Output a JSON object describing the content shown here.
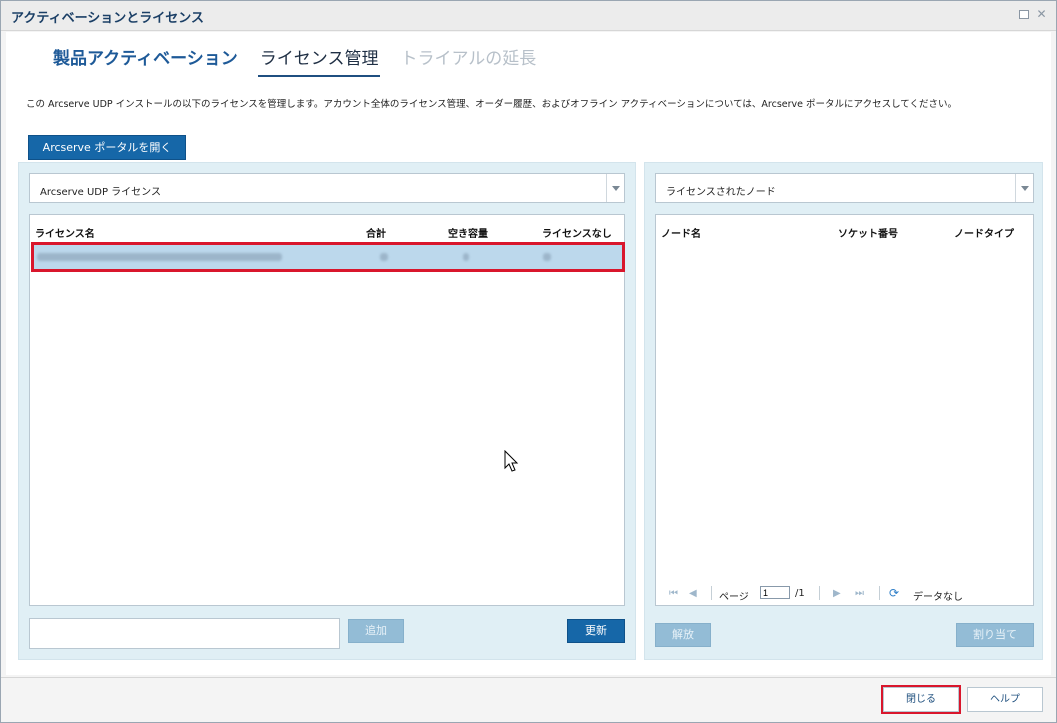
{
  "window": {
    "title": "アクティベーションとライセンス"
  },
  "tabs": [
    {
      "label": "製品アクティベーション"
    },
    {
      "label": "ライセンス管理"
    },
    {
      "label": "トライアルの延長"
    }
  ],
  "description": "この Arcserve UDP インストールの以下のライセンスを管理します。アカウント全体のライセンス管理、オーダー履歴、およびオフライン アクティベーションについては、Arcserve ポータルにアクセスしてください。",
  "portal_button": "Arcserve ポータルを開く",
  "left_panel": {
    "license_type": "Arcserve UDP ライセンス",
    "columns": [
      "ライセンス名",
      "合計",
      "空き容量",
      "ライセンスなし"
    ],
    "add_button": "追加",
    "refresh_button": "更新",
    "input_value": ""
  },
  "right_panel": {
    "node_filter": "ライセンスされたノード",
    "columns": [
      "ノード名",
      "ソケット番号",
      "ノードタイプ"
    ],
    "pager": {
      "page_label": "ページ",
      "page_value": "1",
      "page_total": "/1",
      "status": "データなし"
    },
    "release_button": "解放",
    "assign_button": "割り当て"
  },
  "footer": {
    "close_button": "閉じる",
    "help_button": "ヘルプ"
  },
  "colors": {
    "accent": "#1667a8",
    "panel_bg": "#e0eff5",
    "selection": "#bcd8ec",
    "highlight": "#d9162c"
  }
}
